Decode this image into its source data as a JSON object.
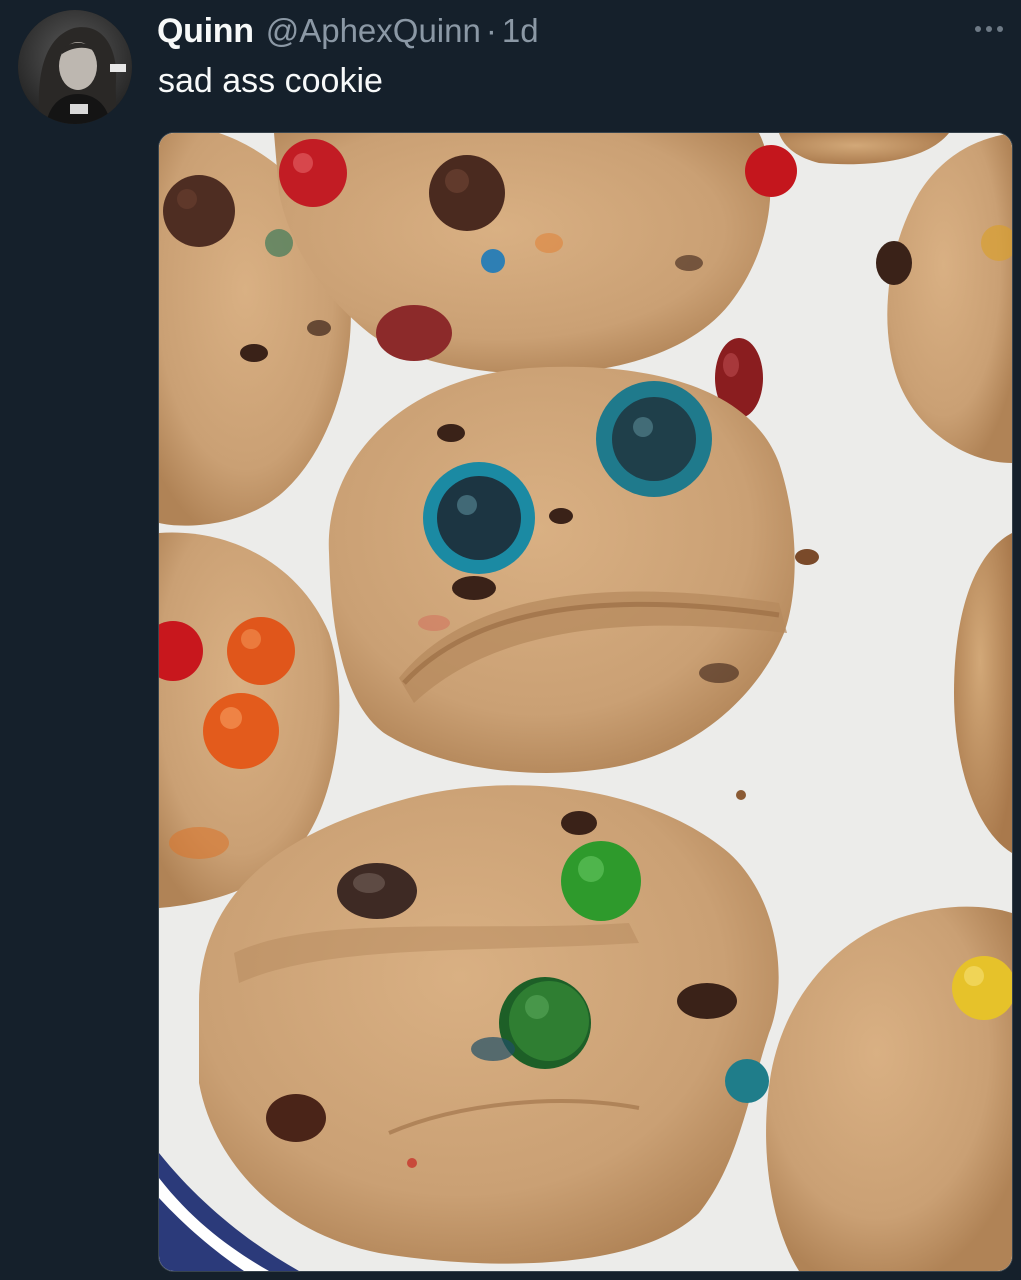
{
  "tweet": {
    "display_name": "Quinn",
    "handle": "@AphexQuinn",
    "separator": "·",
    "timestamp": "1d",
    "text": "sad ass cookie",
    "more_icon": "more-horizontal-icon",
    "avatar": "profile-photo",
    "media": "photo of M&M cookies on a plate, one resembling a sad face"
  },
  "colors": {
    "background": "#15202b",
    "primary_text": "#f7f9f9",
    "secondary_text": "#8b98a5",
    "border": "#38444d"
  }
}
